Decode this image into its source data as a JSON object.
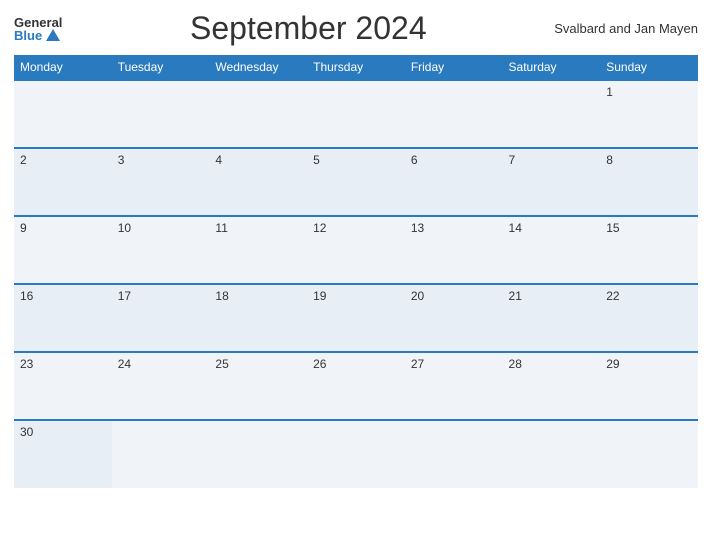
{
  "header": {
    "logo_general": "General",
    "logo_blue": "Blue",
    "title": "September 2024",
    "region": "Svalbard and Jan Mayen"
  },
  "weekdays": [
    "Monday",
    "Tuesday",
    "Wednesday",
    "Thursday",
    "Friday",
    "Saturday",
    "Sunday"
  ],
  "weeks": [
    [
      null,
      null,
      null,
      null,
      null,
      null,
      1
    ],
    [
      2,
      3,
      4,
      5,
      6,
      7,
      8
    ],
    [
      9,
      10,
      11,
      12,
      13,
      14,
      15
    ],
    [
      16,
      17,
      18,
      19,
      20,
      21,
      22
    ],
    [
      23,
      24,
      25,
      26,
      27,
      28,
      29
    ],
    [
      30,
      null,
      null,
      null,
      null,
      null,
      null
    ]
  ]
}
